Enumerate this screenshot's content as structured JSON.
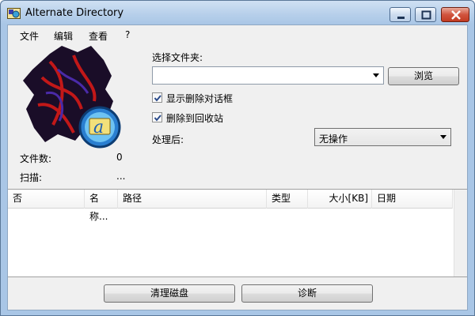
{
  "window": {
    "title": "Alternate Directory",
    "buttons": [
      "minimize-icon",
      "maximize-icon",
      "close-icon"
    ]
  },
  "menu": {
    "items": [
      "文件",
      "编辑",
      "查看",
      "?"
    ]
  },
  "stats": {
    "file_count_label": "文件数:",
    "file_count_value": "0",
    "scan_label": "扫描:",
    "scan_value": "..."
  },
  "folder": {
    "label": "选择文件夹:",
    "value": "",
    "browse_label": "浏览"
  },
  "options": {
    "show_delete_dialog_label": "显示删除对话框",
    "show_delete_dialog_checked": true,
    "delete_to_recycle_label": "删除到回收站",
    "delete_to_recycle_checked": true,
    "after_processing_label": "处理后:",
    "after_processing_value": "无操作"
  },
  "table": {
    "columns": [
      "否",
      "名称...",
      "路径",
      "类型",
      "大小[KB]",
      "日期"
    ],
    "rows": []
  },
  "actions": {
    "clean_disk_label": "清理磁盘",
    "diagnose_label": "诊断"
  },
  "colors": {
    "title_bar": "#b6cfea",
    "client_bg": "#f0f0f0",
    "close_button": "#c23b22"
  }
}
